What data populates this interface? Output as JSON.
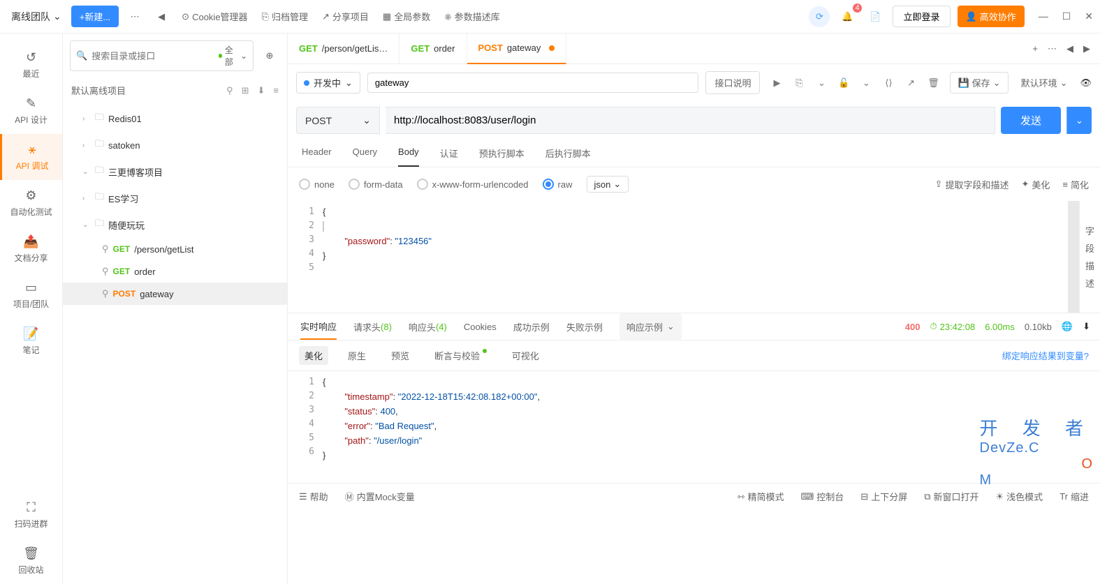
{
  "topbar": {
    "team": "离线团队",
    "new_btn": "+新建...",
    "links": {
      "cookie": "Cookie管理器",
      "archive": "归档管理",
      "share": "分享项目",
      "global": "全局参数",
      "param_lib": "参数描述库"
    },
    "notif_count": "4",
    "login": "立即登录",
    "collab": "高效协作"
  },
  "leftnav": {
    "recent": "最近",
    "api_design": "API 设计",
    "api_debug": "API 调试",
    "auto_test": "自动化测试",
    "doc_share": "文档分享",
    "proj_team": "项目/团队",
    "notes": "笔记",
    "scan": "扫码进群",
    "recycle": "回收站"
  },
  "sidebar": {
    "search_ph": "搜索目录或接口",
    "filter": "全部",
    "project": "默认离线项目",
    "folders": [
      "Redis01",
      "satoken",
      "三更博客项目",
      "ES学习",
      "随便玩玩"
    ],
    "apis": [
      {
        "method": "GET",
        "name": "/person/getList"
      },
      {
        "method": "GET",
        "name": "order"
      },
      {
        "method": "POST",
        "name": "gateway"
      }
    ]
  },
  "tabs": [
    {
      "method": "GET",
      "name": "/person/getLis…"
    },
    {
      "method": "GET",
      "name": "order"
    },
    {
      "method": "POST",
      "name": "gateway",
      "active": true,
      "dirty": true
    }
  ],
  "request": {
    "status": "开发中",
    "name": "gateway",
    "desc_btn": "接口说明",
    "save": "保存",
    "env": "默认环境",
    "method": "POST",
    "url": "http://localhost:8083/user/login",
    "send": "发送",
    "tabs": [
      "Header",
      "Query",
      "Body",
      "认证",
      "预执行脚本",
      "后执行脚本"
    ],
    "body_types": [
      "none",
      "form-data",
      "x-www-form-urlencoded",
      "raw"
    ],
    "raw_type": "json",
    "actions": {
      "extract": "提取字段和描述",
      "beautify": "美化",
      "simplify": "简化"
    },
    "side_label": "字段描述",
    "code_key": "\"password\"",
    "code_val": "\"123456\""
  },
  "response": {
    "tabs": {
      "realtime": "实时响应",
      "req_headers": "请求头",
      "req_headers_n": "(8)",
      "resp_headers": "响应头",
      "resp_headers_n": "(4)",
      "cookies": "Cookies",
      "success": "成功示例",
      "fail": "失败示例",
      "sample": "响应示例"
    },
    "stats": {
      "code": "400",
      "time": "23:42:08",
      "dur": "6.00ms",
      "size": "0.10kb"
    },
    "tools": {
      "beautify": "美化",
      "raw": "原生",
      "preview": "预览",
      "assert": "断言与校验",
      "visual": "可视化"
    },
    "bind": "绑定响应结果到变量?",
    "body": {
      "timestamp_k": "\"timestamp\"",
      "timestamp_v": "\"2022-12-18T15:42:08.182+00:00\"",
      "status_k": "\"status\"",
      "status_v": "400",
      "error_k": "\"error\"",
      "error_v": "\"Bad Request\"",
      "path_k": "\"path\"",
      "path_v": "\"/user/login\""
    }
  },
  "footer": {
    "help": "帮助",
    "mock": "内置Mock变量",
    "compact": "精简模式",
    "console": "控制台",
    "split": "上下分屏",
    "newwin": "新窗口打开",
    "theme": "浅色模式",
    "indent": "缩进"
  },
  "watermark": {
    "cn": "开 发 者",
    "en_pre": "DevZe.C",
    "en_o": "O",
    "en_m": "M"
  }
}
